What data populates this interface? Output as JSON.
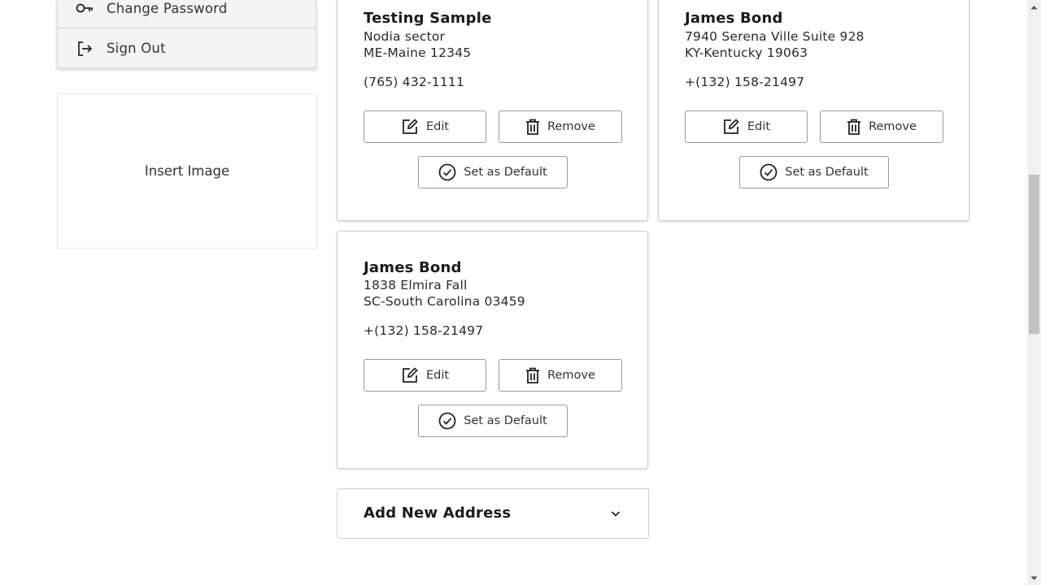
{
  "sidebar": {
    "menu": [
      {
        "label": "Change Password",
        "icon": "key-icon"
      },
      {
        "label": "Sign Out",
        "icon": "sign-out-icon"
      }
    ],
    "insert_image_label": "Insert Image"
  },
  "addresses": [
    {
      "name": "Testing Sample",
      "line1": "Nodia sector",
      "line2": "ME-Maine 12345",
      "phone": "(765) 432-1111"
    },
    {
      "name": "James Bond",
      "line1": "7940 Serena Ville Suite 928",
      "line2": "KY-Kentucky 19063",
      "phone": "+(132) 158-21497"
    },
    {
      "name": "James Bond",
      "line1": "1838 Elmira Fall",
      "line2": "SC-South Carolina 03459",
      "phone": "+(132) 158-21497"
    }
  ],
  "buttons": {
    "edit": "Edit",
    "remove": "Remove",
    "set_default": "Set as Default"
  },
  "add_new_address": {
    "label": "Add New Address",
    "icon": "chevron-down-icon"
  },
  "icons": {
    "edit": "edit-icon",
    "remove": "trash-icon",
    "set_default": "check-circle-icon"
  }
}
